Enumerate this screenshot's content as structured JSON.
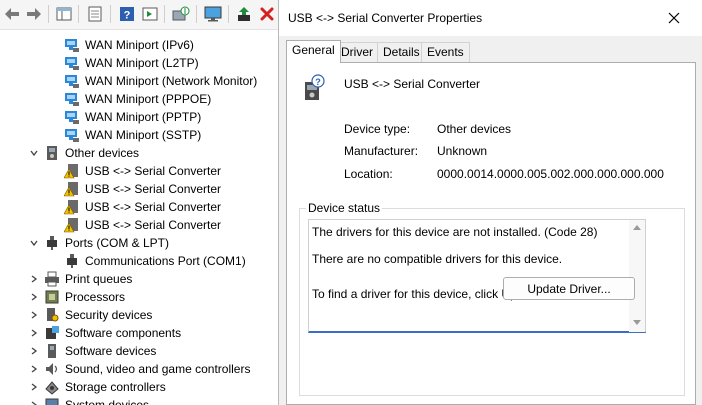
{
  "toolbar": {
    "buttons": [
      "back-icon",
      "forward-icon",
      "show-hide-console-tree-icon",
      "properties-icon",
      "help-icon",
      "action-pane-icon",
      "scan-hardware-icon",
      "display-icon",
      "update-driver-icon",
      "uninstall-icon"
    ]
  },
  "tree": {
    "items": [
      {
        "label": "WAN Miniport (IPv6)",
        "icon": "network-adapter-icon"
      },
      {
        "label": "WAN Miniport (L2TP)",
        "icon": "network-adapter-icon"
      },
      {
        "label": "WAN Miniport (Network Monitor)",
        "icon": "network-adapter-icon"
      },
      {
        "label": "WAN Miniport (PPPOE)",
        "icon": "network-adapter-icon"
      },
      {
        "label": "WAN Miniport (PPTP)",
        "icon": "network-adapter-icon"
      },
      {
        "label": "WAN Miniport (SSTP)",
        "icon": "network-adapter-icon"
      },
      {
        "label": "Other devices",
        "icon": "other-devices-icon",
        "expanded": true
      },
      {
        "label": "USB <-> Serial Converter",
        "icon": "warning-device-icon"
      },
      {
        "label": "USB <-> Serial Converter",
        "icon": "warning-device-icon"
      },
      {
        "label": "USB <-> Serial Converter",
        "icon": "warning-device-icon"
      },
      {
        "label": "USB <-> Serial Converter",
        "icon": "warning-device-icon"
      },
      {
        "label": "Ports (COM & LPT)",
        "icon": "ports-icon",
        "expanded": true
      },
      {
        "label": "Communications Port (COM1)",
        "icon": "com-port-icon"
      },
      {
        "label": "Print queues",
        "icon": "printer-icon"
      },
      {
        "label": "Processors",
        "icon": "processor-icon"
      },
      {
        "label": "Security devices",
        "icon": "security-device-icon"
      },
      {
        "label": "Software components",
        "icon": "software-component-icon"
      },
      {
        "label": "Software devices",
        "icon": "software-device-icon"
      },
      {
        "label": "Sound, video and game controllers",
        "icon": "speaker-icon"
      },
      {
        "label": "Storage controllers",
        "icon": "storage-icon"
      },
      {
        "label": "System devices",
        "icon": "system-device-icon"
      }
    ]
  },
  "dialog": {
    "title": "USB <-> Serial Converter Properties",
    "tabs": [
      {
        "label": "General",
        "active": true
      },
      {
        "label": "Driver",
        "active": false
      },
      {
        "label": "Details",
        "active": false
      },
      {
        "label": "Events",
        "active": false
      }
    ],
    "device_name": "USB <-> Serial Converter",
    "device_type_label": "Device type:",
    "device_type_value": "Other devices",
    "manufacturer_label": "Manufacturer:",
    "manufacturer_value": "Unknown",
    "location_label": "Location:",
    "location_value": "0000.0014.0000.005.002.000.000.000.000",
    "status_title": "Device status",
    "status_lines": [
      "The drivers for this device are not installed. (Code 28)",
      "There are no compatible drivers for this device.",
      "To find a driver for this device, click Update Driver."
    ],
    "update_button": "Update Driver..."
  },
  "colors": {
    "warning": "#f2c200",
    "network": "#2b88d8",
    "close": "#d42020",
    "green": "#1e8c3c",
    "focus_border": "#3c6ccb"
  }
}
